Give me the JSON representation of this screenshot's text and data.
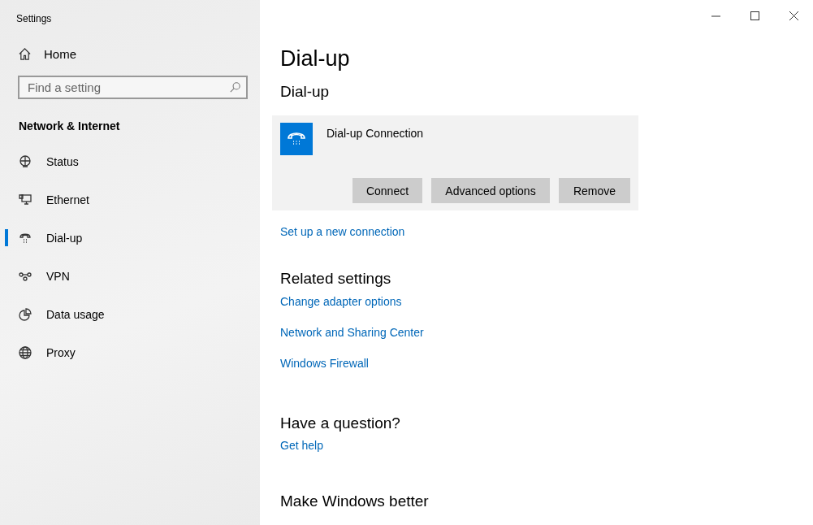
{
  "window": {
    "title": "Settings"
  },
  "sidebar": {
    "home": "Home",
    "search": {
      "placeholder": "Find a setting"
    },
    "section": "Network & Internet",
    "items": [
      {
        "label": "Status",
        "selected": false
      },
      {
        "label": "Ethernet",
        "selected": false
      },
      {
        "label": "Dial-up",
        "selected": true
      },
      {
        "label": "VPN",
        "selected": false
      },
      {
        "label": "Data usage",
        "selected": false
      },
      {
        "label": "Proxy",
        "selected": false
      }
    ]
  },
  "main": {
    "title": "Dial-up",
    "subtitle": "Dial-up",
    "connection": {
      "name": "Dial-up Connection",
      "buttons": [
        "Connect",
        "Advanced options",
        "Remove"
      ]
    },
    "setup_link": "Set up a new connection",
    "related": {
      "heading": "Related settings",
      "links": [
        "Change adapter options",
        "Network and Sharing Center",
        "Windows Firewall"
      ]
    },
    "question": {
      "heading": "Have a question?",
      "link": "Get help"
    },
    "feedback": {
      "heading": "Make Windows better"
    }
  }
}
